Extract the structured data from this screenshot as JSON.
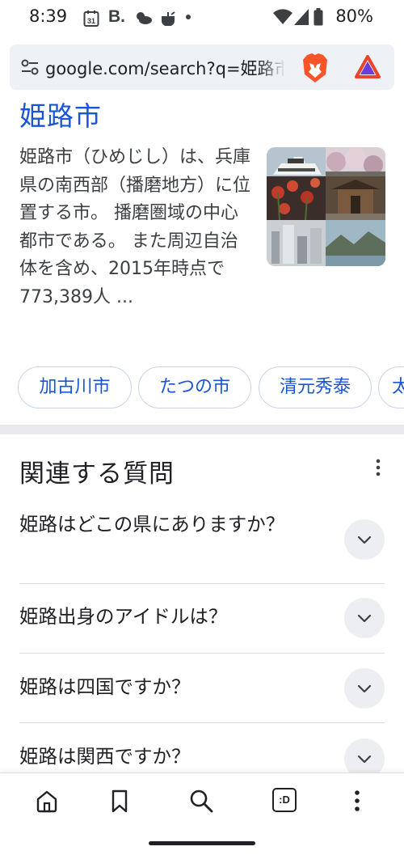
{
  "status_bar": {
    "time": "8:39",
    "calendar_day": "31",
    "b_label": "B.",
    "battery": "80%"
  },
  "url_bar": {
    "url": "google.com/search?q=姫路市"
  },
  "result": {
    "title": "姫路市",
    "description": "姫路市（ひめじし）は、兵庫県の南西部（播磨地方）に位置する市。 播磨圏域の中心都市である。 また周辺自治体を含め、2015年時点で773,389人 ..."
  },
  "chips": [
    "加古川市",
    "たつの市",
    "清元秀泰",
    "太"
  ],
  "related": {
    "title": "関連する質問",
    "questions": [
      "姫路はどこの県にありますか？",
      "姫路出身のアイドルは？",
      "姫路は四国ですか？",
      "姫路は関西ですか？"
    ]
  },
  "bottom_nav": {
    "tab_badge": ":D"
  },
  "colors": {
    "link_blue": "#1a55d6",
    "url_bar_bg": "#eef1f5",
    "brave_orange": "#fb542b"
  }
}
